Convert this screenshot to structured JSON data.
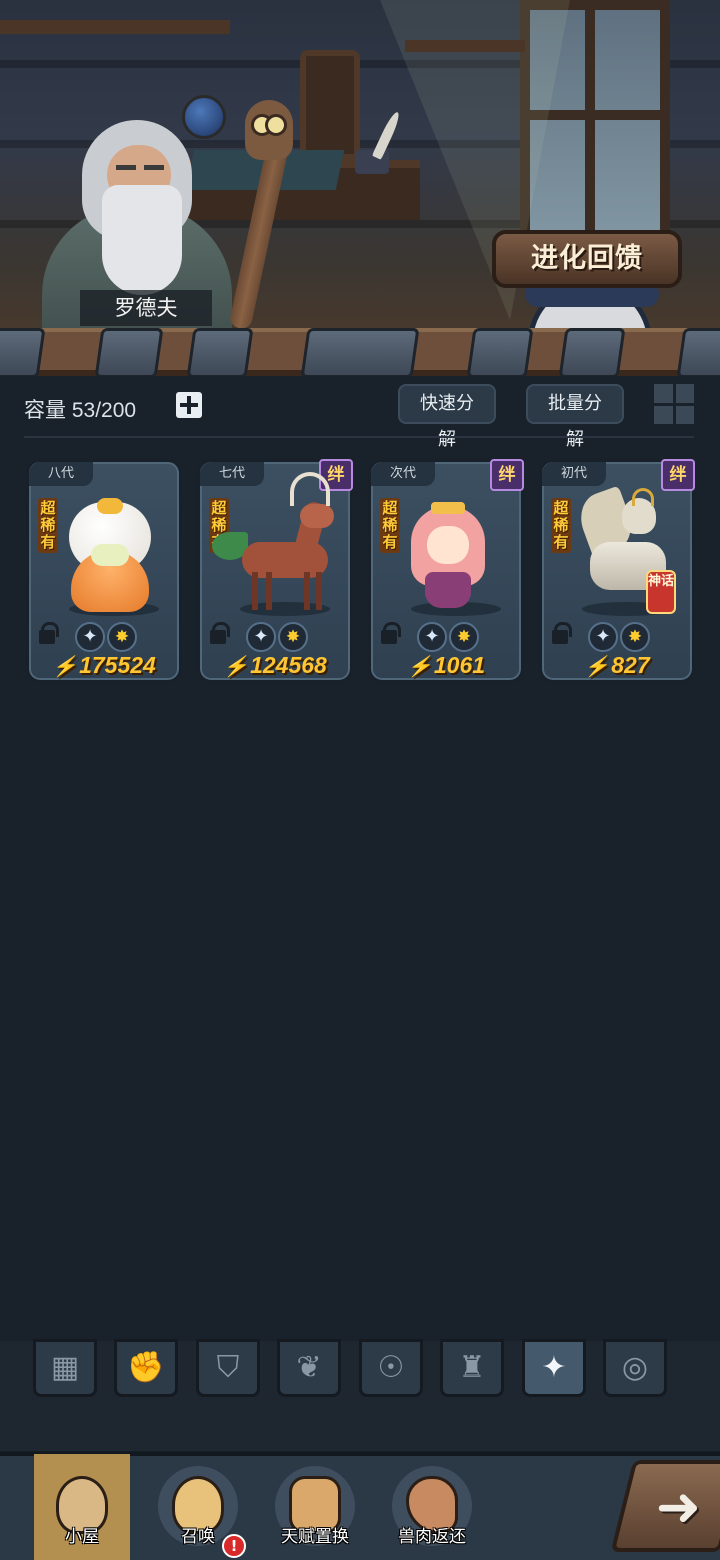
{
  "scene": {
    "npc_name": "罗德夫",
    "evolve_button": "进化回馈"
  },
  "inventory": {
    "capacity_label": "容量 53/200",
    "quick_decompose": "快速分解",
    "batch_decompose": "批量分解"
  },
  "cards": [
    {
      "generation": "八代",
      "rarity": "超稀有",
      "bond": "",
      "power": "175524",
      "creature": "orange-mushroom"
    },
    {
      "generation": "七代",
      "rarity": "超稀有",
      "bond": "绊",
      "power": "124568",
      "creature": "antlered-deer"
    },
    {
      "generation": "次代",
      "rarity": "超稀有",
      "bond": "绊",
      "power": "1061",
      "creature": "pink-hair-girl"
    },
    {
      "generation": "初代",
      "rarity": "超稀有",
      "bond": "绊",
      "power": "827",
      "creature": "white-gold-dragon",
      "badge": "神话"
    }
  ],
  "power_symbol": "⚡",
  "filters": [
    {
      "icon": "blocks-icon",
      "glyph": "▦"
    },
    {
      "icon": "fist-icon",
      "glyph": "✊"
    },
    {
      "icon": "shield-icon",
      "glyph": "⛉"
    },
    {
      "icon": "sprout-icon",
      "glyph": "❦"
    },
    {
      "icon": "alien-icon",
      "glyph": "☉"
    },
    {
      "icon": "tower-icon",
      "glyph": "♜"
    },
    {
      "icon": "star-compass-icon",
      "glyph": "✦",
      "active": true
    },
    {
      "icon": "swirl-icon",
      "glyph": "◎"
    }
  ],
  "nav": {
    "hut": "小屋",
    "summon": "召唤",
    "talent": "天赋置换",
    "meat": "兽肉返还",
    "alert": "!"
  },
  "next_arrow": "➜",
  "colors": {
    "accent_gold": "#ffc533",
    "panel_bg": "#19212a",
    "card_bg": "#3c5062",
    "bond_purple": "#4a2e6a",
    "alert_red": "#d82a2a"
  }
}
